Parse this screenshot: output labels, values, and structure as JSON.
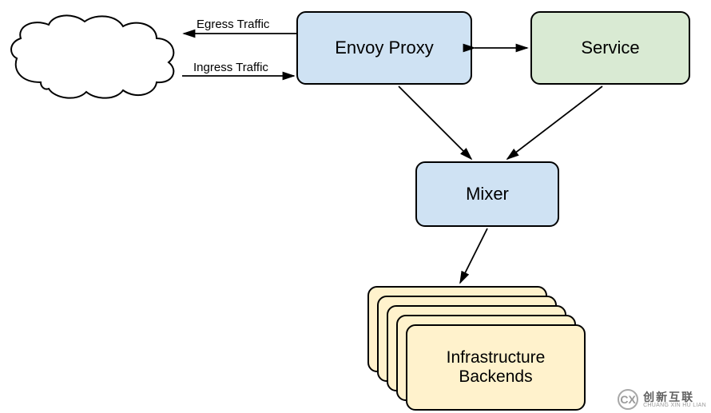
{
  "nodes": {
    "envoy": "Envoy Proxy",
    "service": "Service",
    "mixer": "Mixer",
    "backends_line1": "Infrastructure",
    "backends_line2": "Backends"
  },
  "labels": {
    "egress": "Egress Traffic",
    "ingress": "Ingress Traffic"
  },
  "watermark": {
    "icon": "CX",
    "cn": "创新互联",
    "en": "CHUANG XIN HU LIAN"
  }
}
